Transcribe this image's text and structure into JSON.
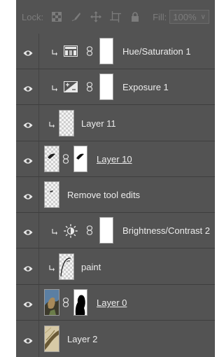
{
  "lockbar": {
    "lock_label": "Lock:",
    "icons": [
      "lock-transparent-pixels-icon",
      "lock-image-pixels-icon",
      "lock-position-icon",
      "lock-artboard-icon",
      "lock-all-icon"
    ],
    "fill_label": "Fill:",
    "fill_value": "100%"
  },
  "layers": [
    {
      "name": "Hue/Saturation 1",
      "kind": "adjustment",
      "adjustment_icon": "hue-saturation-icon",
      "clipped": true,
      "has_mask": true,
      "underline": false
    },
    {
      "name": "Exposure 1",
      "kind": "adjustment",
      "adjustment_icon": "exposure-icon",
      "clipped": true,
      "has_mask": true,
      "underline": false
    },
    {
      "name": "Layer 11",
      "kind": "pixel",
      "clipped": true,
      "has_mask": false,
      "underline": false
    },
    {
      "name": "Layer 10",
      "kind": "pixel",
      "clipped": false,
      "has_mask": true,
      "underline": true
    },
    {
      "name": "Remove tool edits",
      "kind": "pixel",
      "clipped": false,
      "has_mask": false,
      "underline": false
    },
    {
      "name": "Brightness/Contrast 2",
      "kind": "adjustment",
      "adjustment_icon": "brightness-contrast-icon",
      "clipped": true,
      "has_mask": true,
      "underline": false
    },
    {
      "name": "paint",
      "kind": "pixel",
      "clipped": true,
      "has_mask": false,
      "underline": false
    },
    {
      "name": "Layer 0",
      "kind": "photo",
      "clipped": false,
      "has_mask": true,
      "underline": true
    },
    {
      "name": "Layer 2",
      "kind": "photo",
      "clipped": false,
      "has_mask": false,
      "underline": false
    }
  ]
}
